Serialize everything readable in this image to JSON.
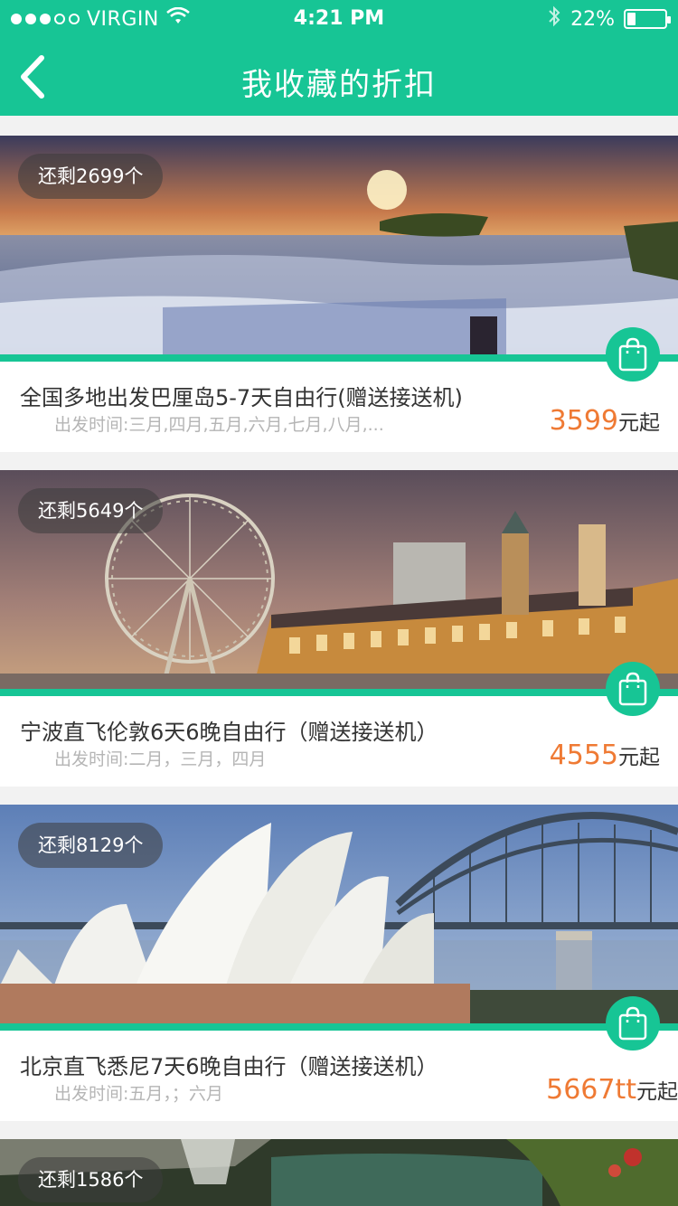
{
  "status_bar": {
    "carrier": "VIRGIN",
    "time": "4:21 PM",
    "battery": "22%",
    "battery_level": 0.22,
    "icons": [
      "signal-dots-icon",
      "wifi-icon",
      "bluetooth-icon",
      "battery-icon"
    ]
  },
  "nav": {
    "title": "我收藏的折扣",
    "back_icon": "chevron-left-icon"
  },
  "colors": {
    "brand": "#17c595",
    "price": "#ef7a34",
    "text_primary": "#333333",
    "text_muted": "#b5b5b5"
  },
  "cards": [
    {
      "badge": "还剩2699个",
      "title": "全国多地出发巴厘岛5-7天自由行(赠送接送机)",
      "departure": "出发时间:三月,四月,五月,六月,七月,八月,...",
      "price": "3599",
      "price_unit": "元起",
      "image": "bali-seascape-sunset"
    },
    {
      "badge": "还剩5649个",
      "title": "宁波直飞伦敦6天6晚自由行（赠送接送机）",
      "departure": "出发时间:二月，三月，四月",
      "price": "4555",
      "price_unit": "元起",
      "image": "london-eye-county-hall"
    },
    {
      "badge": "还剩8129个",
      "title": "北京直飞悉尼7天6晚自由行（赠送接送机）",
      "departure": "出发时间:五月，；六月",
      "price": "5667tt",
      "price_unit": "元起",
      "image": "sydney-opera-house"
    },
    {
      "badge": "还剩1586个",
      "image": "waterfall-garden"
    }
  ]
}
